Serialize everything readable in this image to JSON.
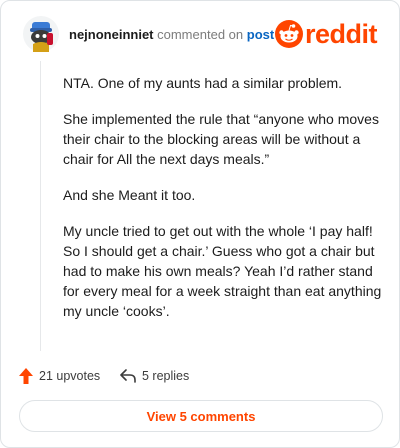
{
  "header": {
    "username": "nejnoneinniet",
    "action_text": "commented on",
    "post_link": "post",
    "brand_text": "reddit",
    "icons": {
      "avatar": "snoo-avatar",
      "logo": "reddit-logo-icon"
    }
  },
  "comment": {
    "paragraphs": [
      "NTA. One of my aunts had a similar problem.",
      "She implemented the rule that “anyone who moves their chair to the blocking areas will be without a chair for All the next days meals.”",
      "And she Meant it too.",
      "My uncle tried to get out with the whole ‘I pay half! So I should get a chair.’ Guess who got a chair but had to make his own meals? Yeah I’d rather stand for every meal for a week straight than eat anything my uncle ‘cooks’."
    ]
  },
  "actions": {
    "upvotes": "21 upvotes",
    "replies": "5 replies",
    "icons": {
      "upvote": "upvote-arrow-icon",
      "reply": "reply-arrow-icon"
    }
  },
  "footer": {
    "view_comments": "View 5 comments"
  },
  "colors": {
    "brand": "#ff4500",
    "link": "#0a66c2",
    "border": "#dfe3e6"
  }
}
